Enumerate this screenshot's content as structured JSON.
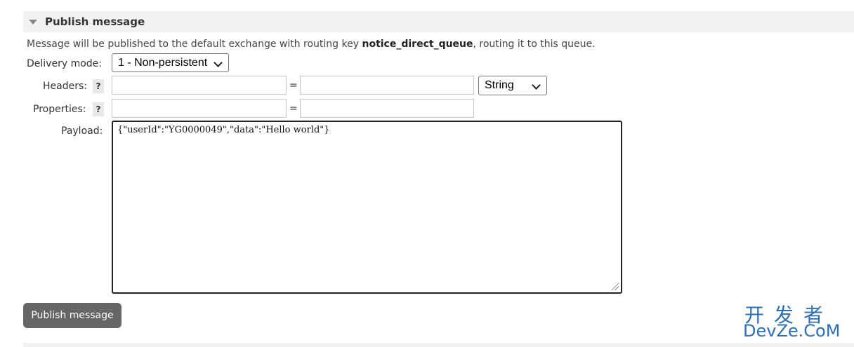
{
  "section": {
    "title": "Publish message"
  },
  "intro": {
    "prefix": "Message will be published to the default exchange with routing key ",
    "routing_key": "notice_direct_queue",
    "suffix": ", routing it to this queue."
  },
  "delivery_mode": {
    "label": "Delivery mode:",
    "selected": "1 - Non-persistent"
  },
  "headers": {
    "label": "Headers:",
    "help": "?",
    "key_value": "",
    "equals": "=",
    "value_value": "",
    "type_selected": "String"
  },
  "properties": {
    "label": "Properties:",
    "help": "?",
    "key_value": "",
    "equals": "=",
    "value_value": ""
  },
  "payload": {
    "label": "Payload:",
    "value": "{\"userId\":\"YG0000049\",\"data\":\"Hello world\"}"
  },
  "publish_button": {
    "label": "Publish message"
  },
  "watermark": {
    "line1": "开发者",
    "line2": "DevZe.CoM"
  },
  "colors": {
    "button_bg": "#666666",
    "header_bg": "#f2f2f2",
    "watermark": "#2b6fb6"
  }
}
